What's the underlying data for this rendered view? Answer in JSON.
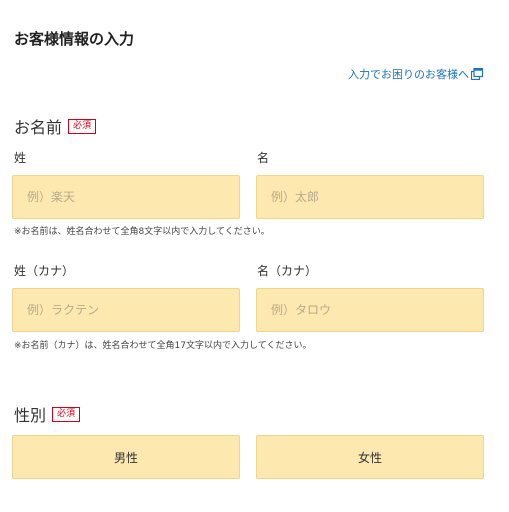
{
  "page": {
    "title": "お客様情報の入力",
    "help_link": "入力でお困りのお客様へ"
  },
  "name_section": {
    "label": "お名前",
    "required": "必須",
    "last_name": {
      "label": "姓",
      "placeholder": "例）楽天"
    },
    "first_name": {
      "label": "名",
      "placeholder": "例）太郎"
    },
    "note": "※お名前は、姓名合わせて全角8文字以内で入力してください。"
  },
  "kana_section": {
    "last_name": {
      "label": "姓（カナ）",
      "placeholder": "例）ラクテン"
    },
    "first_name": {
      "label": "名（カナ）",
      "placeholder": "例）タロウ"
    },
    "note": "※お名前（カナ）は、姓名合わせて全角17文字以内で入力してください。"
  },
  "gender_section": {
    "label": "性別",
    "required": "必須",
    "options": [
      "男性",
      "女性"
    ]
  },
  "colors": {
    "input_bg": "#fde8b0",
    "link": "#1a73c4",
    "required": "#d0021b"
  },
  "icons": {
    "help_link": "external-window-icon"
  }
}
